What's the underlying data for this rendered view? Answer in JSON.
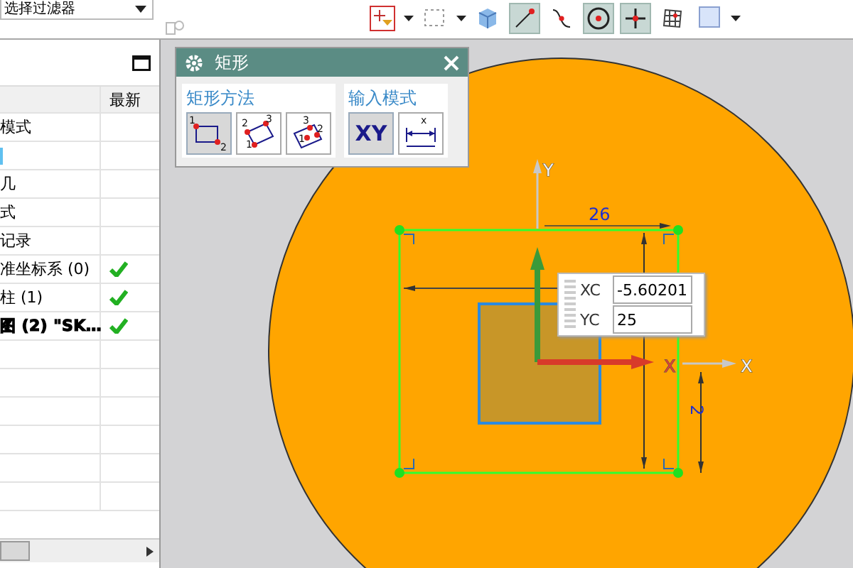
{
  "toolbar": {
    "filter_dropdown": {
      "value": "选择过滤器"
    },
    "tools": [
      {
        "kind": "snap-filter",
        "selected": false
      },
      {
        "kind": "rect-select",
        "selected": false
      },
      {
        "kind": "cube",
        "selected": false
      },
      {
        "kind": "line",
        "selected": true
      },
      {
        "kind": "curve",
        "selected": false
      },
      {
        "kind": "circle",
        "selected": true
      },
      {
        "kind": "point",
        "selected": true
      },
      {
        "kind": "grid",
        "selected": false
      },
      {
        "kind": "view",
        "selected": false
      }
    ]
  },
  "navigator": {
    "column_2": "最新",
    "rows": [
      {
        "name": "模式",
        "latest": false,
        "current": false
      },
      {
        "latest": false,
        "current": false
      },
      {
        "name": "几",
        "latest": false,
        "current": false
      },
      {
        "name": "式",
        "latest": false,
        "current": false
      },
      {
        "name": "记录",
        "latest": false,
        "current": false
      },
      {
        "name": "准坐标系 (0)",
        "latest": true,
        "current": false
      },
      {
        "name": "柱 (1)",
        "latest": true,
        "current": false
      },
      {
        "name": "图 (2) \"SK…",
        "latest": true,
        "current": true
      }
    ]
  },
  "dialog": {
    "title": "矩形",
    "groups": [
      {
        "label": "矩形方法",
        "buttons": [
          {
            "kind": "two-point",
            "selected": true,
            "digits": [
              "1",
              "2"
            ]
          },
          {
            "kind": "three-point",
            "selected": false,
            "digits": [
              "2",
              "3",
              "1"
            ]
          },
          {
            "kind": "center",
            "selected": false,
            "digits": [
              "3",
              "2",
              "1"
            ]
          }
        ]
      },
      {
        "label": "输入模式",
        "buttons": [
          {
            "kind": "xy",
            "selected": true,
            "label": "XY"
          },
          {
            "kind": "parameter",
            "selected": false,
            "digits": [
              "x"
            ]
          }
        ]
      }
    ]
  },
  "coordinate_input": {
    "fields": [
      {
        "label": "XC",
        "value": "-5.60201"
      },
      {
        "label": "YC",
        "value": "25"
      }
    ]
  },
  "sketch": {
    "dimension_labels": [
      {
        "text": "26",
        "vertical": false
      },
      {
        "text": "2",
        "vertical": true
      }
    ],
    "axes": [
      {
        "kind": "sketch-x",
        "label": "X"
      },
      {
        "kind": "wcs-x",
        "label": "X"
      },
      {
        "kind": "wcs-y",
        "label": "Y"
      }
    ]
  }
}
